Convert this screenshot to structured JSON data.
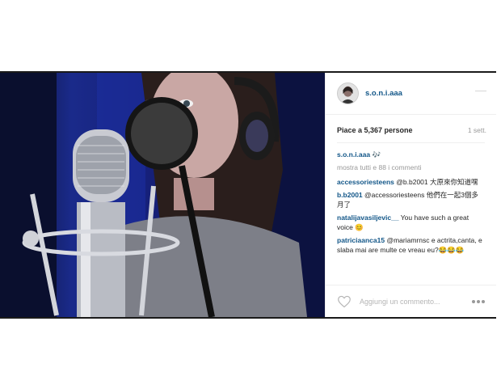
{
  "post": {
    "username": "s.o.n.i.aaa",
    "likes_text": "Piace a 5,367 persone",
    "time_ago": "1 sett.",
    "caption": {
      "author": "s.o.n.i.aaa",
      "text": "🎶"
    },
    "view_all": "mostra tutti e 88 i commenti",
    "comments": [
      {
        "author": "accessoriesteens",
        "text": "@b.b2001 大原來你知道嘿"
      },
      {
        "author": "b.b2001",
        "text": "@accessoriesteens 他們在一起3個多月了"
      },
      {
        "author": "natalijavasiljevic__",
        "text": "You have such a great voice 😊"
      },
      {
        "author": "patriciaanca15",
        "text": "@mariamrnsc e actrita,canta, e slaba mai are multe ce vreau eu?😂😂😂"
      }
    ],
    "add_comment_placeholder": "Aggiungi un commento...",
    "link_color": "#125688"
  }
}
